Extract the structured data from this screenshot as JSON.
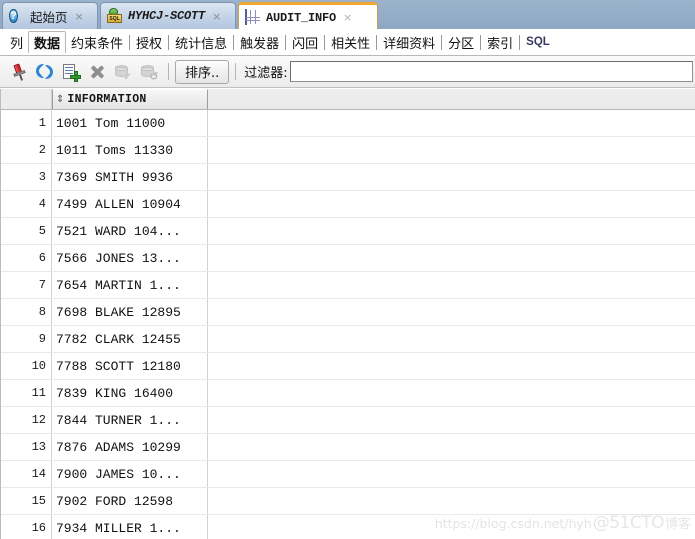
{
  "window_tabs": [
    {
      "label": "起始页",
      "icon": "help-circle-icon",
      "active": false,
      "close": "×"
    },
    {
      "label": "HYHCJ-SCOTT",
      "icon": "sql-connection-icon",
      "active": false,
      "close": "×"
    },
    {
      "label": "AUDIT_INFO",
      "icon": "table-grid-icon",
      "active": true,
      "close": "×"
    }
  ],
  "category_tabs": [
    {
      "label": "列",
      "selected": false
    },
    {
      "label": "数据",
      "selected": true
    },
    {
      "label": "约束条件",
      "selected": false
    },
    {
      "label": "授权",
      "selected": false
    },
    {
      "label": "统计信息",
      "selected": false
    },
    {
      "label": "触发器",
      "selected": false
    },
    {
      "label": "闪回",
      "selected": false
    },
    {
      "label": "相关性",
      "selected": false
    },
    {
      "label": "详细资料",
      "selected": false
    },
    {
      "label": "分区",
      "selected": false
    },
    {
      "label": "索引",
      "selected": false
    },
    {
      "label": "SQL",
      "selected": false
    }
  ],
  "toolbar": {
    "buttons": [
      {
        "name": "freeze-pin-icon",
        "enabled": true
      },
      {
        "name": "refresh-icon",
        "enabled": true
      },
      {
        "name": "insert-row-icon",
        "enabled": true
      },
      {
        "name": "delete-row-icon",
        "enabled": true
      },
      {
        "name": "commit-icon",
        "enabled": false
      },
      {
        "name": "rollback-icon",
        "enabled": false
      }
    ],
    "sort_label": "排序..",
    "filter_label": "过滤器:",
    "filter_value": "",
    "filter_placeholder": ""
  },
  "grid": {
    "column_header": "INFORMATION",
    "sort_glyph": "⇕",
    "rows": [
      {
        "n": "1",
        "information": "1001 Tom 11000"
      },
      {
        "n": "2",
        "information": "1011 Toms 11330"
      },
      {
        "n": "3",
        "information": "7369 SMITH 9936"
      },
      {
        "n": "4",
        "information": "7499 ALLEN 10904"
      },
      {
        "n": "5",
        "information": "7521 WARD 104..."
      },
      {
        "n": "6",
        "information": "7566 JONES 13..."
      },
      {
        "n": "7",
        "information": "7654 MARTIN 1..."
      },
      {
        "n": "8",
        "information": "7698 BLAKE 12895"
      },
      {
        "n": "9",
        "information": "7782 CLARK 12455"
      },
      {
        "n": "10",
        "information": "7788 SCOTT 12180"
      },
      {
        "n": "11",
        "information": "7839 KING 16400"
      },
      {
        "n": "12",
        "information": "7844 TURNER 1..."
      },
      {
        "n": "13",
        "information": "7876 ADAMS 10299"
      },
      {
        "n": "14",
        "information": "7900 JAMES 10..."
      },
      {
        "n": "15",
        "information": "7902 FORD 12598"
      },
      {
        "n": "16",
        "information": "7934 MILLER 1..."
      }
    ]
  },
  "watermark": {
    "url": "https://blog.csdn.net/hyh",
    "brand": "@51CTO",
    "suffix": "博客"
  },
  "colors": {
    "tabbar_bg": "#93abc8",
    "active_tab_accent": "#f0a830",
    "grid_header_bg": "#ececec",
    "pin_red": "#c01414",
    "refresh_blue": "#2f86d6",
    "plus_green": "#2f9e2f"
  }
}
